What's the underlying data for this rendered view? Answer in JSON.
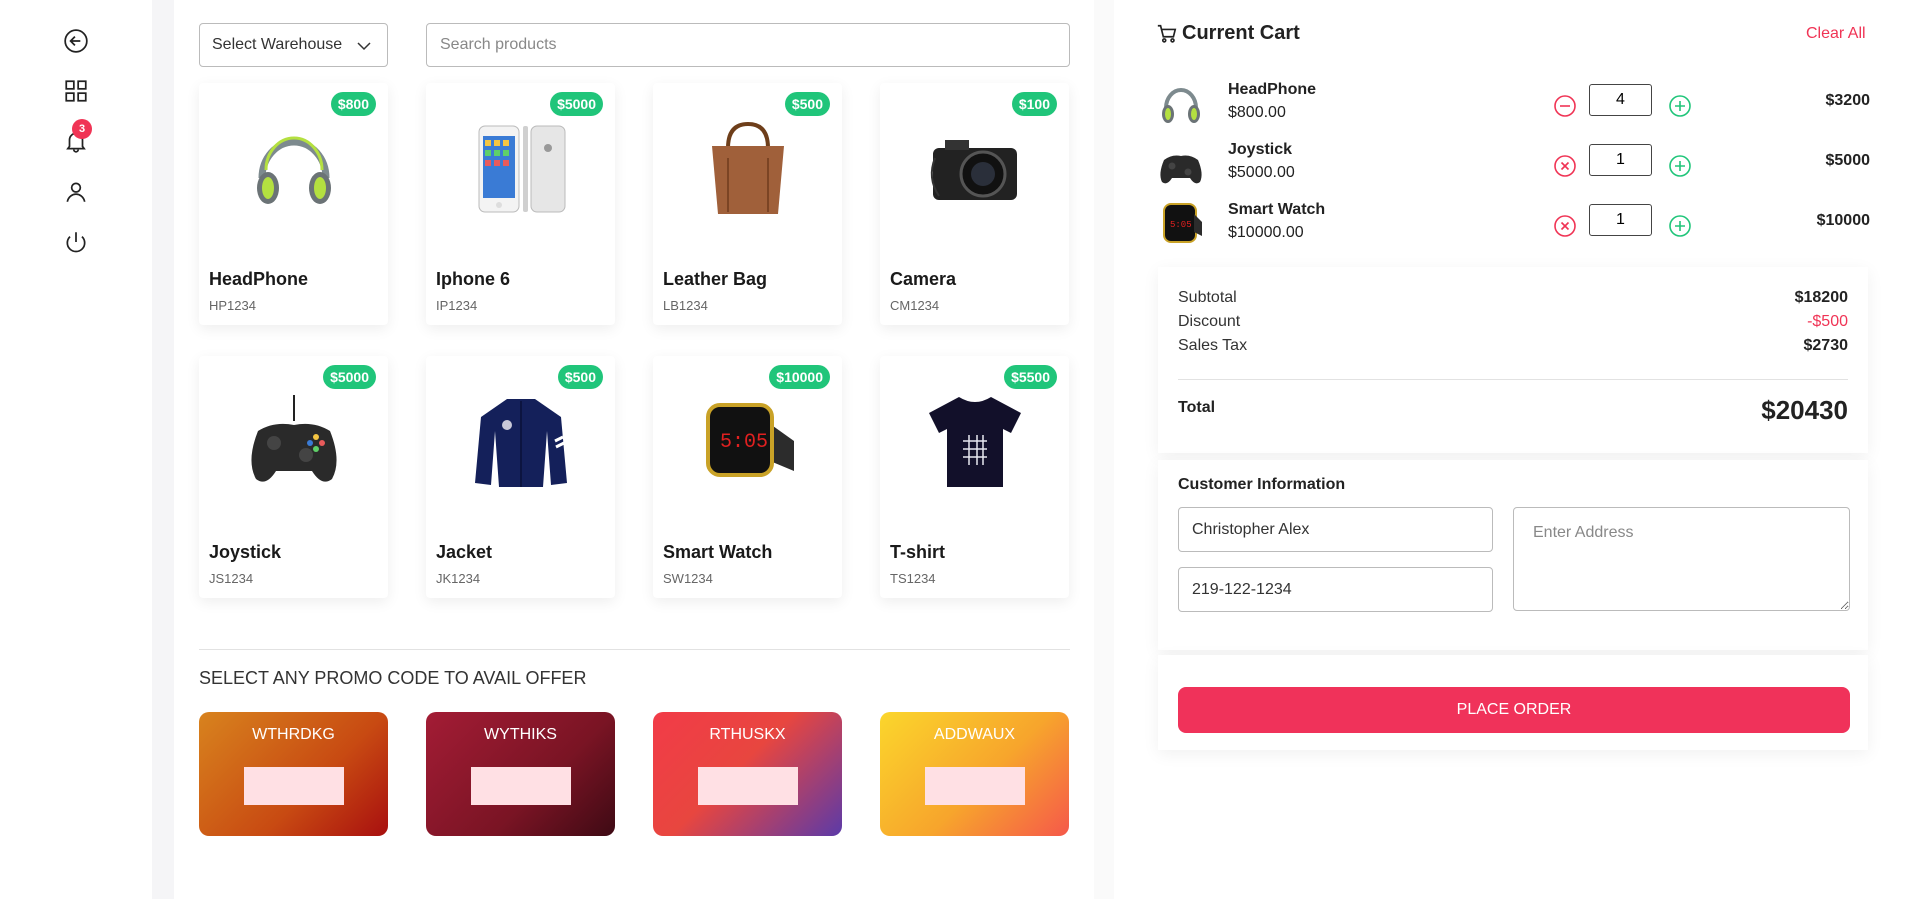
{
  "sidebar": {
    "items": [
      {
        "icon": "back-icon"
      },
      {
        "icon": "grid-icon"
      },
      {
        "icon": "bell-icon",
        "badge": "3"
      },
      {
        "icon": "user-icon"
      },
      {
        "icon": "power-icon"
      }
    ]
  },
  "toolbar": {
    "warehouse_label": "Select Warehouse",
    "search_placeholder": "Search products"
  },
  "products": [
    {
      "name": "HeadPhone",
      "code": "HP1234",
      "price": "$800"
    },
    {
      "name": "Iphone 6",
      "code": "IP1234",
      "price": "$5000"
    },
    {
      "name": "Leather Bag",
      "code": "LB1234",
      "price": "$500"
    },
    {
      "name": "Camera",
      "code": "CM1234",
      "price": "$100"
    },
    {
      "name": "Joystick",
      "code": "JS1234",
      "price": "$5000"
    },
    {
      "name": "Jacket",
      "code": "JK1234",
      "price": "$500"
    },
    {
      "name": "Smart Watch",
      "code": "SW1234",
      "price": "$10000"
    },
    {
      "name": "T-shirt",
      "code": "TS1234",
      "price": "$5500"
    }
  ],
  "promo": {
    "title": "SELECT ANY PROMO CODE TO AVAIL OFFER",
    "codes": [
      "WTHRDKG",
      "WYTHIKS",
      "RTHUSKX",
      "ADDWAUX"
    ]
  },
  "cart": {
    "title": "Current Cart",
    "clear_label": "Clear All",
    "items": [
      {
        "name": "HeadPhone",
        "unit_price": "$800.00",
        "qty": "4",
        "total": "$3200"
      },
      {
        "name": "Joystick",
        "unit_price": "$5000.00",
        "qty": "1",
        "total": "$5000"
      },
      {
        "name": "Smart Watch",
        "unit_price": "$10000.00",
        "qty": "1",
        "total": "$10000"
      }
    ],
    "summary": {
      "subtotal_label": "Subtotal",
      "subtotal": "$18200",
      "discount_label": "Discount",
      "discount": "-$500",
      "tax_label": "Sales Tax",
      "tax": "$2730",
      "total_label": "Total",
      "total": "$20430"
    }
  },
  "customer": {
    "title": "Customer Information",
    "name_value": "Christopher Alex",
    "phone_value": "219-122-1234",
    "address_placeholder": "Enter Address"
  },
  "order": {
    "button_label": "PLACE ORDER"
  },
  "colors": {
    "accent": "#f0325a",
    "badge_green": "#20c57a"
  }
}
